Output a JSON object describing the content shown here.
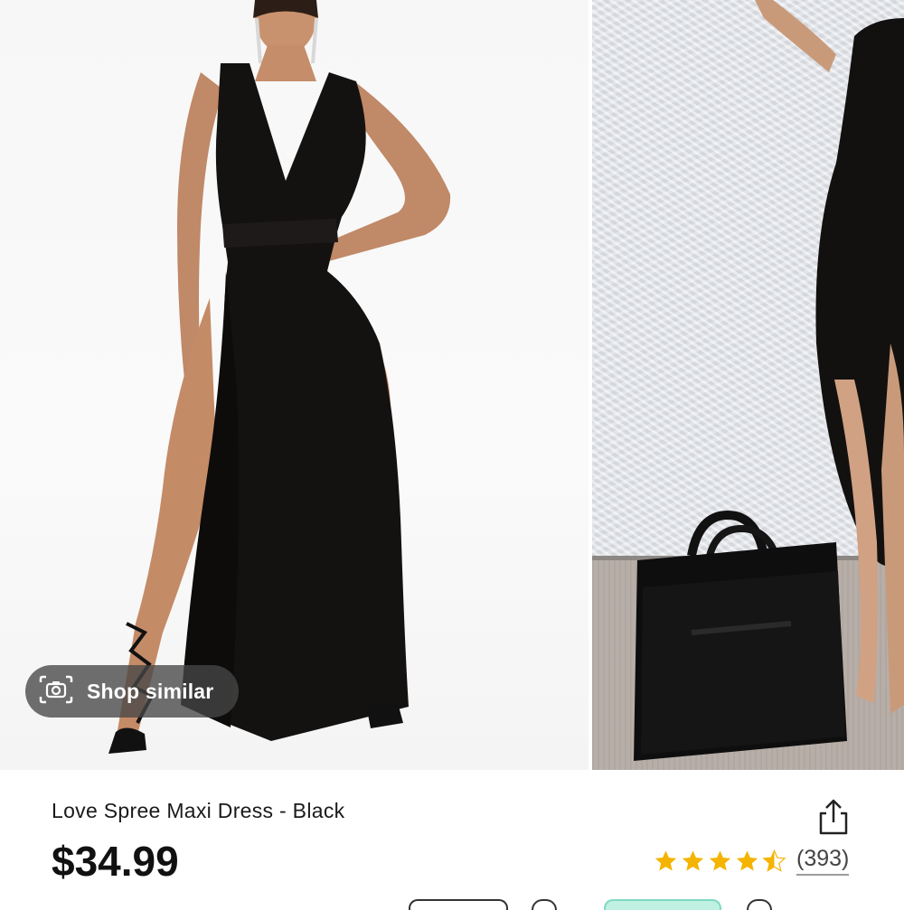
{
  "gallery": {
    "shop_similar_label": "Shop similar",
    "camera_icon": "camera-search-icon"
  },
  "product": {
    "title": "Love Spree Maxi Dress - Black",
    "price": "$34.99",
    "rating": 4.5,
    "review_count": "(393)",
    "share_icon": "share-icon",
    "star_color": "#f4b400"
  }
}
